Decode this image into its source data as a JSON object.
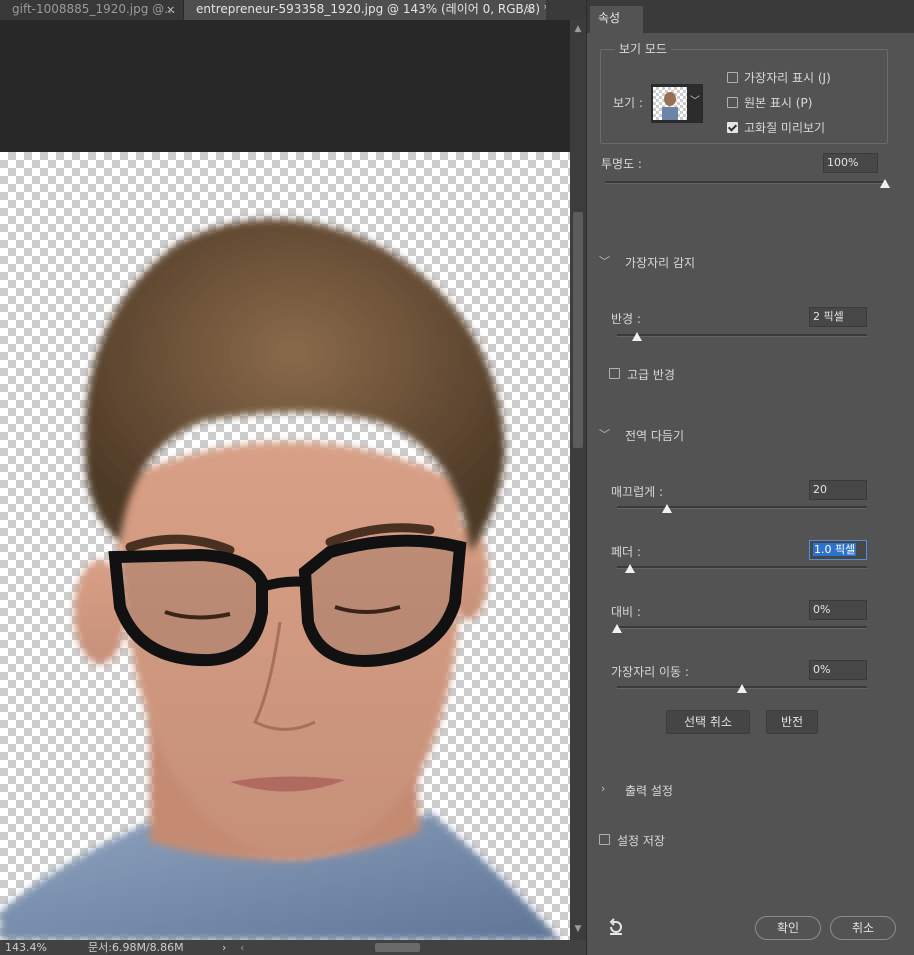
{
  "document_tabs": [
    {
      "label": "gift-1008885_1920.jpg @...",
      "close": "×",
      "active": false
    },
    {
      "label": "entrepreneur-593358_1920.jpg @ 143% (레이어 0, RGB/8) *",
      "close": "×",
      "active": true
    }
  ],
  "status_bar": {
    "zoom": "143.4%",
    "doc_size": "문서:6.98M/8.86M",
    "arrow": "›",
    "scroll_left": "‹"
  },
  "panel": {
    "tab_label": "속성",
    "view_mode": {
      "legend": "보기 모드",
      "view_label": "보기 :",
      "show_edge": "가장자리 표시 (J)",
      "show_edge_checked": false,
      "show_original": "원본 표시 (P)",
      "show_original_checked": false,
      "high_quality_preview": "고화질 미리보기",
      "high_quality_preview_checked": true
    },
    "opacity": {
      "label": "투명도 :",
      "value": "100%",
      "level": 1.0
    },
    "edge_detection": {
      "title": "가장자리 감지",
      "radius_label": "반경 :",
      "radius_value": "2 픽셀",
      "radius_level": 0.08,
      "smart_radius": "고급 반경",
      "smart_radius_checked": false
    },
    "global_refinements": {
      "title": "전역 다듬기",
      "smooth_label": "매끄럽게 :",
      "smooth_value": "20",
      "smooth_level": 0.2,
      "feather_label": "페더 :",
      "feather_value": "1.0 픽셀",
      "feather_level": 0.05,
      "contrast_label": "대비 :",
      "contrast_value": "0%",
      "contrast_level": 0.0,
      "shift_edge_label": "가장자리 이동 :",
      "shift_edge_value": "0%",
      "shift_edge_level": 0.5,
      "clear_selection": "선택 취소",
      "invert": "반전"
    },
    "output_settings": {
      "title": "출력 설정"
    },
    "remember_settings": {
      "label": "설정 저장",
      "checked": false
    },
    "ok": "확인",
    "cancel": "취소"
  },
  "icons": {
    "tab_close": "close-icon",
    "reset": "reset-icon",
    "chevron_open": "chevron-down-icon",
    "chevron_closed": "chevron-right-icon",
    "checkbox_check": "checkmark-icon"
  },
  "colors": {
    "panel_bg": "#535353",
    "canvas_bg": "#282828",
    "selection_blue": "#2f72c9"
  }
}
